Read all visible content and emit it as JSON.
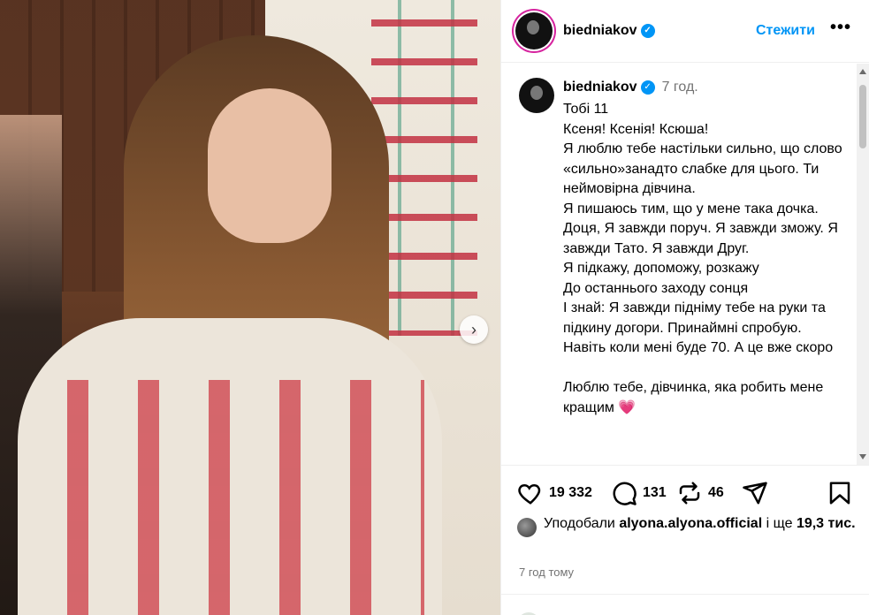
{
  "post": {
    "username": "biedniakov",
    "follow_label": "Стежити",
    "more_label": "•••",
    "time_short": "7 год.",
    "caption": "Тобі 11\nКсеня! Ксенія! Ксюша!\nЯ люблю тебе настільки сильно, що слово «сильно»занадто слабке для цього. Ти неймовірна дівчина.\nЯ пишаюсь тим, що у мене така дочка. Доця, Я завжди поруч. Я завжди зможу. Я завжди Тато. Я завжди Друг.\nЯ підкажу, допоможу, розкажу\nДо останнього заходу сонця\nІ знай: Я завжди підніму тебе на руки та підкину догори. Принаймні спробую. Навіть коли мені буде 70. А це вже скоро\n\nЛюблю тебе, дівчинка, яка робить мене кращим",
    "caption_emoji": "💗",
    "likes_count": "19 332",
    "comments_count": "131",
    "reposts_count": "46",
    "liked_by_prefix": "Уподобали",
    "liked_by_user": "alyona.alyona.official",
    "liked_by_suffix": "і ще",
    "liked_by_others": "19,3 тис.",
    "timestamp": "7 год тому"
  },
  "icons": {
    "next": "chevron-right-icon",
    "verified": "verified-badge-icon",
    "like": "heart-icon",
    "comment": "comment-icon",
    "repost": "repost-icon",
    "share": "send-icon",
    "save": "bookmark-icon"
  },
  "colors": {
    "accent": "#0095f6",
    "muted": "#737373",
    "story_ring": "#d6249f"
  }
}
